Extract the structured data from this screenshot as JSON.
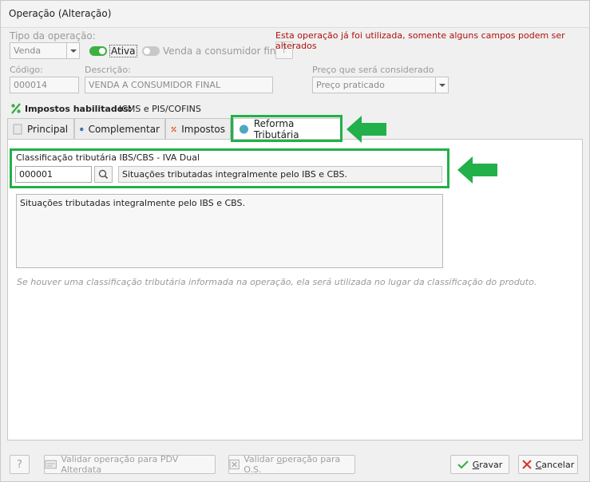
{
  "window": {
    "title": "Operação (Alteração)"
  },
  "header": {
    "tipo_label": "Tipo da operação:",
    "tipo_value": "Venda",
    "ativa_label": "Ativa",
    "consumidor_label": "Venda a consumidor final",
    "help_label": "?",
    "warning": "Esta operação já foi utilizada, somente alguns campos podem ser alterados",
    "codigo_label": "Código:",
    "codigo_value": "000014",
    "descricao_label": "Descrição:",
    "descricao_value": "VENDA A CONSUMIDOR FINAL",
    "preco_label": "Preço que será considerado",
    "preco_value": "Preço praticado",
    "impostos_label": "Impostos habilitados:",
    "impostos_value": "ICMS e PIS/COFINS"
  },
  "tabs": [
    {
      "label": "Principal",
      "icon": "document-icon"
    },
    {
      "label": "Complementar",
      "icon": "more-icon"
    },
    {
      "label": "Impostos",
      "icon": "percent-icon"
    },
    {
      "label": "Reforma Tributária",
      "icon": "globe-icon"
    }
  ],
  "reforma": {
    "classificacao_label": "Classificação tributária IBS/CBS - IVA Dual",
    "codigo_value": "000001",
    "descricao_value": "Situações tributadas integralmente pelo IBS e CBS.",
    "detalhe_text": "Situações tributadas integralmente pelo IBS e CBS.",
    "hint": "Se houver uma classificação tributária informada na operação, ela será utilizada no lugar da classificação do produto."
  },
  "footer": {
    "help_label": "?",
    "validar_pdv_label": "Validar operação para PDV Alterdata",
    "validar_os_label_pre": "Validar ",
    "validar_os_label_u": "o",
    "validar_os_label_post": "peração para O.S.",
    "gravar_label_u": "G",
    "gravar_label_rest": "ravar",
    "cancelar_label_u": "C",
    "cancelar_label_rest": "ancelar"
  },
  "colors": {
    "highlight": "#22b04a",
    "warning": "#b01010",
    "toggle_on": "#3cb043"
  }
}
